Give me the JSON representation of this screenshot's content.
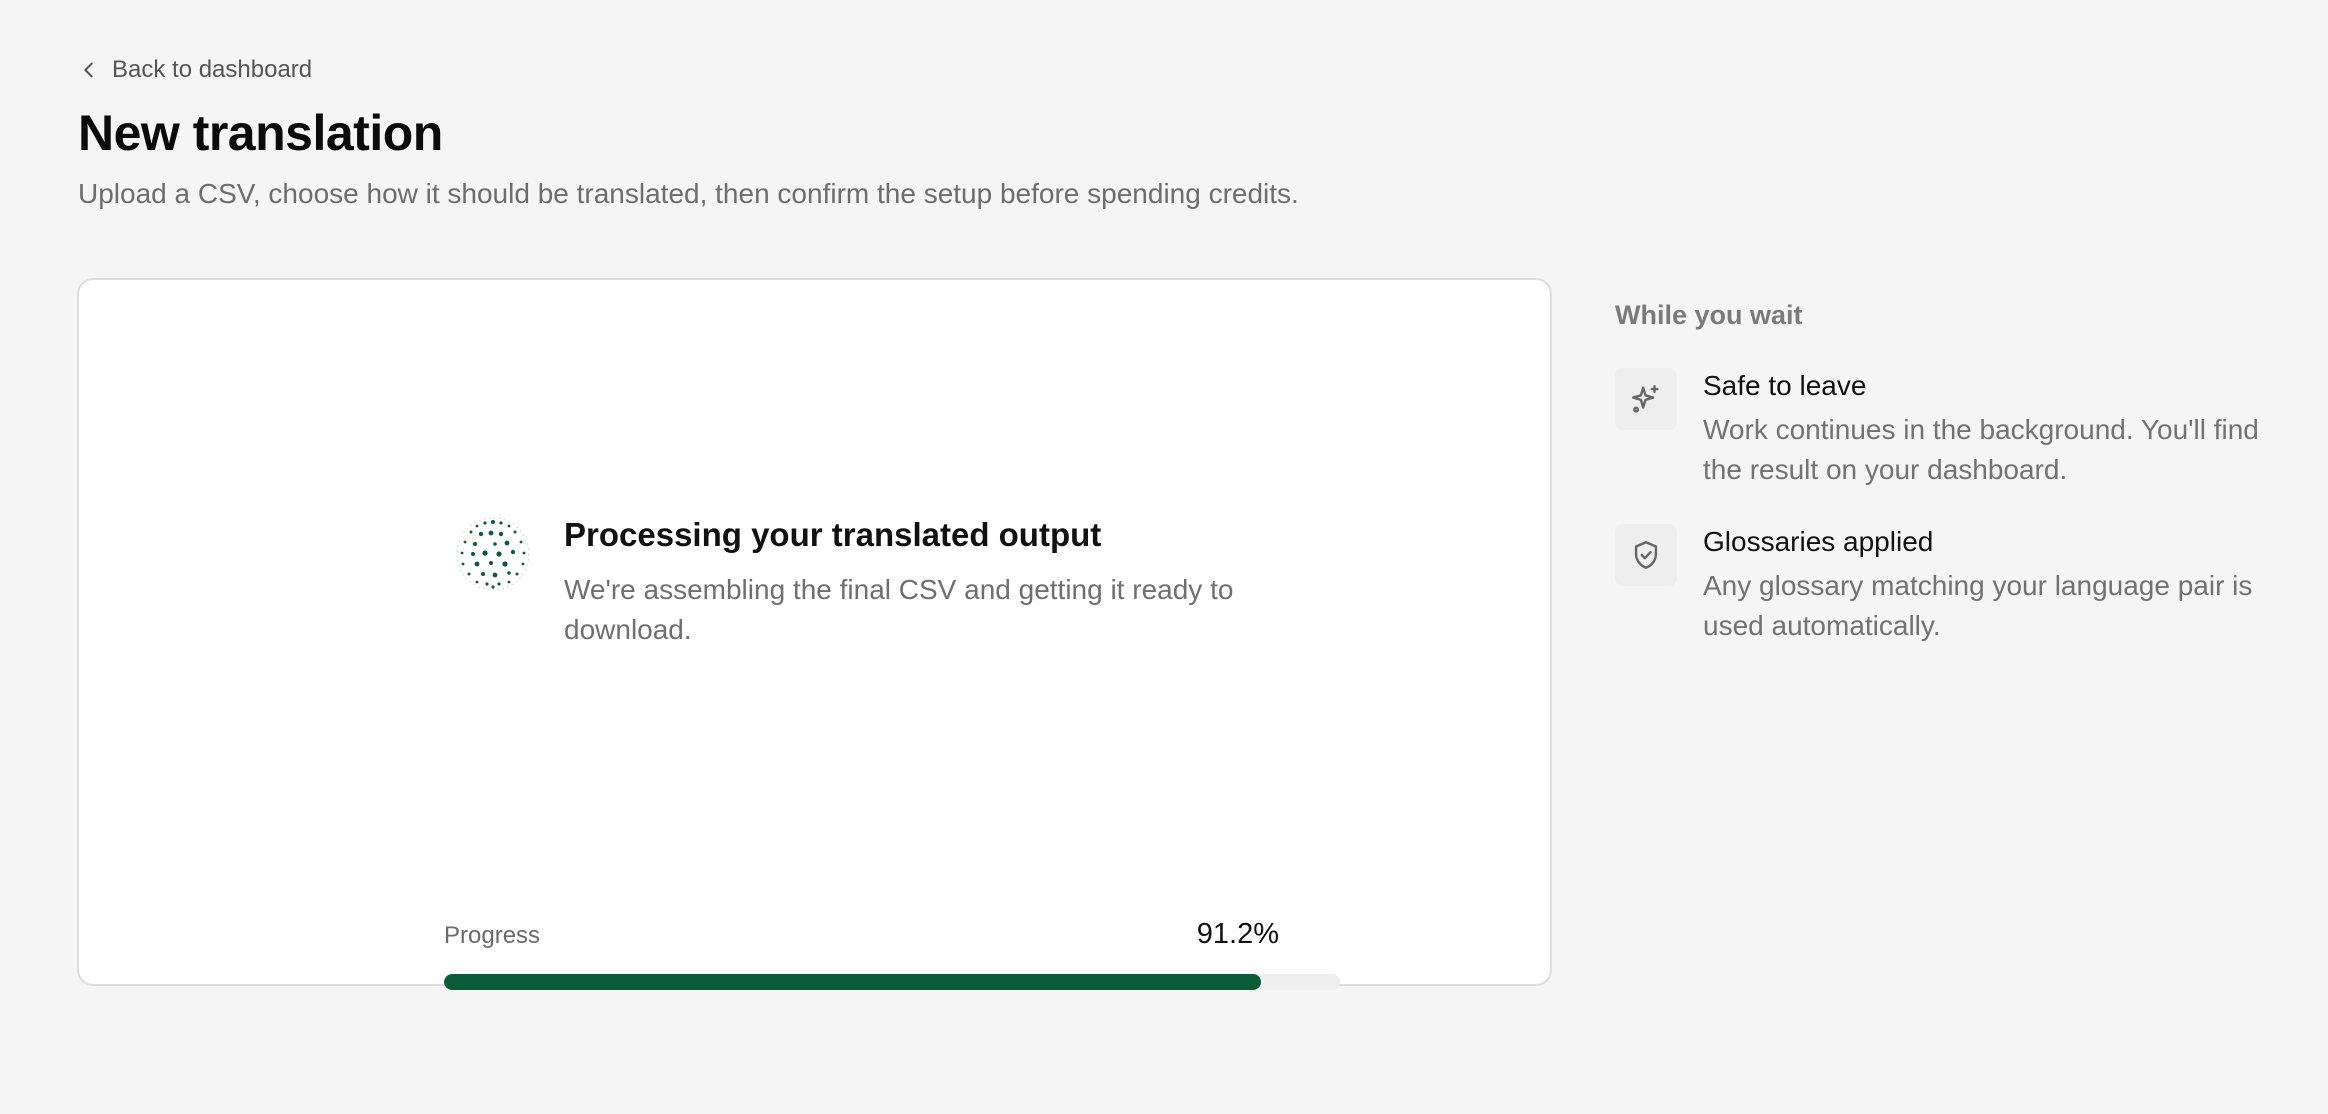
{
  "nav": {
    "back_label": "Back to dashboard"
  },
  "header": {
    "title": "New translation",
    "subtitle": "Upload a CSV, choose how it should be translated, then confirm the setup before spending credits."
  },
  "status": {
    "icon": "globe-icon",
    "title": "Processing your translated output",
    "description": "We're assembling the final CSV and getting it ready to download."
  },
  "progress": {
    "label": "Progress",
    "value_text": "91.2%",
    "fraction": 0.912
  },
  "aside": {
    "title": "While you wait",
    "items": [
      {
        "icon": "sparkles-icon",
        "title": "Safe to leave",
        "description": "Work continues in the background. You'll find the result on your dashboard."
      },
      {
        "icon": "shield-check-icon",
        "title": "Glossaries applied",
        "description": "Any glossary matching your language pair is used automatically."
      }
    ]
  },
  "colors": {
    "accent": "#0a5c36",
    "background": "#f5f5f5",
    "card": "#ffffff"
  }
}
